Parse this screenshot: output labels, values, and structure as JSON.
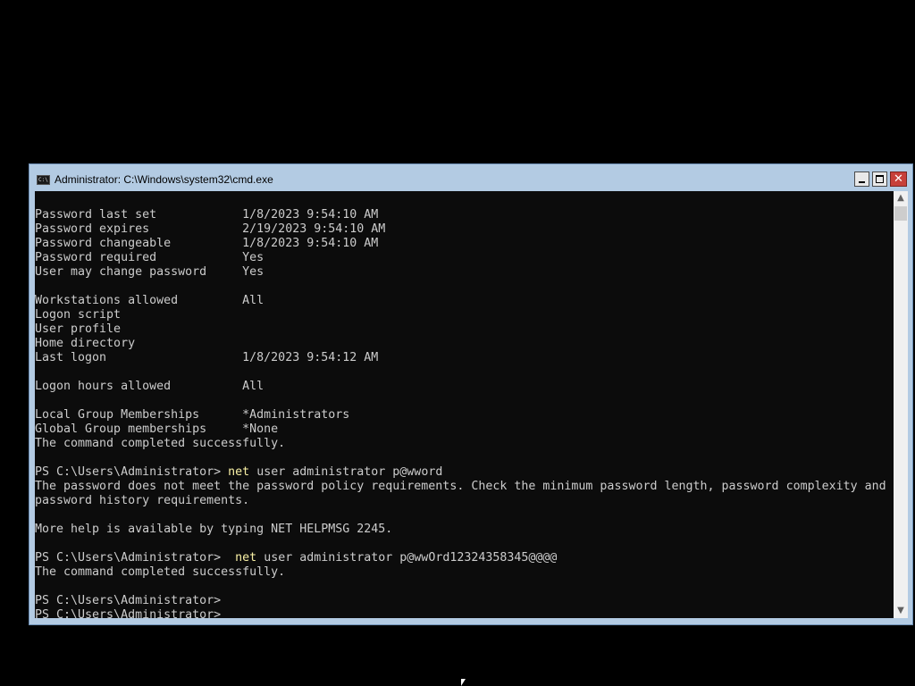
{
  "window": {
    "title": "Administrator: C:\\Windows\\system32\\cmd.exe",
    "icon": "cmd-icon",
    "controls": {
      "minimize": "minimize-icon",
      "maximize": "maximize-icon",
      "close": "close-icon",
      "close_glyph": "✕"
    }
  },
  "console": {
    "lines": [
      "Password last set            1/8/2023 9:54:10 AM",
      "Password expires             2/19/2023 9:54:10 AM",
      "Password changeable          1/8/2023 9:54:10 AM",
      "Password required            Yes",
      "User may change password     Yes",
      "",
      "Workstations allowed         All",
      "Logon script",
      "User profile",
      "Home directory",
      "Last logon                   1/8/2023 9:54:12 AM",
      "",
      "Logon hours allowed          All",
      "",
      "Local Group Memberships      *Administrators",
      "Global Group memberships     *None",
      "The command completed successfully.",
      "",
      {
        "prompt": "PS C:\\Users\\Administrator> ",
        "cmd": "net",
        "rest": " user administrator p@wword"
      },
      "The password does not meet the password policy requirements. Check the minimum password length, password complexity and",
      "password history requirements.",
      "",
      "More help is available by typing NET HELPMSG 2245.",
      "",
      {
        "prompt": "PS C:\\Users\\Administrator>  ",
        "cmd": "net",
        "rest": " user administrator p@wwOrd12324358345@@@@"
      },
      "The command completed successfully.",
      "",
      "PS C:\\Users\\Administrator>",
      "PS C:\\Users\\Administrator>"
    ]
  },
  "scrollbar": {
    "up": "▲",
    "down": "▼"
  },
  "colors": {
    "console_bg": "#0c0c0c",
    "console_fg": "#cccccc",
    "command": "#f9f1a5",
    "titlebar": "#b3cbe3"
  }
}
